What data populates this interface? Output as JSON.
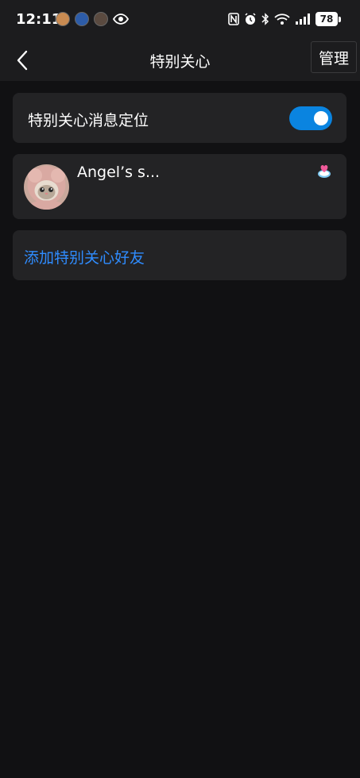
{
  "status_bar": {
    "time": "12:11",
    "battery": "78"
  },
  "nav": {
    "title": "特别关心",
    "manage_label": "管理"
  },
  "settings": {
    "toggle_label": "特别关心消息定位",
    "toggle_on": true
  },
  "friends": [
    {
      "name": "Angel’s s..."
    }
  ],
  "add_friend_label": "添加特别关心好友",
  "colors": {
    "accent_blue": "#0a84e0",
    "link_blue": "#2f8cff",
    "card_bg": "#232325",
    "page_bg": "#111113",
    "bar_bg": "#1c1c1e"
  }
}
